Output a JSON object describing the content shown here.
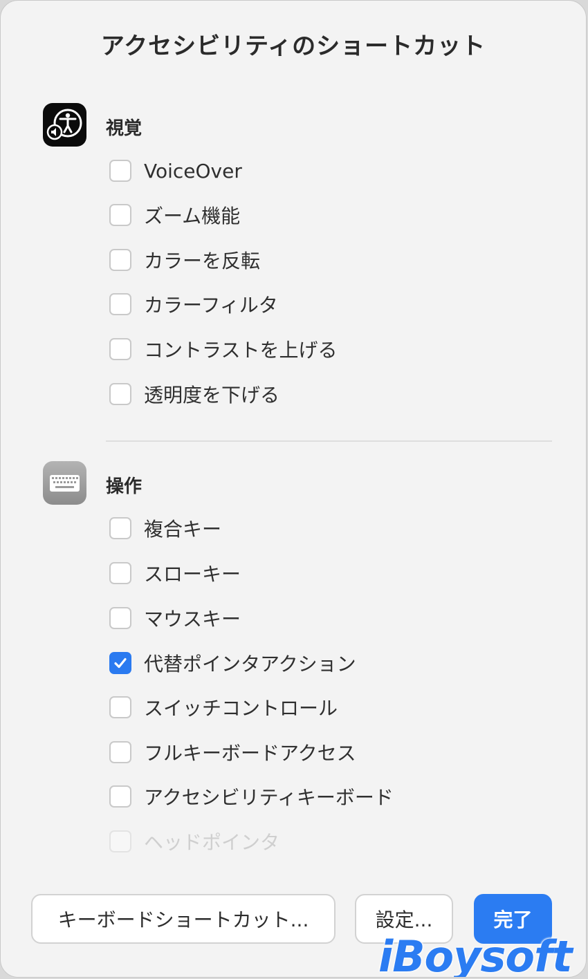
{
  "dialog": {
    "title": "アクセシビリティのショートカット"
  },
  "sections": [
    {
      "title": "視覚",
      "icon": "accessibility-icon",
      "items": [
        {
          "label": "VoiceOver",
          "checked": false,
          "enabled": true
        },
        {
          "label": "ズーム機能",
          "checked": false,
          "enabled": true
        },
        {
          "label": "カラーを反転",
          "checked": false,
          "enabled": true
        },
        {
          "label": "カラーフィルタ",
          "checked": false,
          "enabled": true
        },
        {
          "label": "コントラストを上げる",
          "checked": false,
          "enabled": true
        },
        {
          "label": "透明度を下げる",
          "checked": false,
          "enabled": true
        }
      ]
    },
    {
      "title": "操作",
      "icon": "keyboard-icon",
      "items": [
        {
          "label": "複合キー",
          "checked": false,
          "enabled": true
        },
        {
          "label": "スローキー",
          "checked": false,
          "enabled": true
        },
        {
          "label": "マウスキー",
          "checked": false,
          "enabled": true
        },
        {
          "label": "代替ポインタアクション",
          "checked": true,
          "enabled": true
        },
        {
          "label": "スイッチコントロール",
          "checked": false,
          "enabled": true
        },
        {
          "label": "フルキーボードアクセス",
          "checked": false,
          "enabled": true
        },
        {
          "label": "アクセシビリティキーボード",
          "checked": false,
          "enabled": true
        },
        {
          "label": "ヘッドポインタ",
          "checked": false,
          "enabled": false
        }
      ]
    }
  ],
  "buttons": {
    "keyboard_shortcuts": "キーボードショートカット...",
    "settings": "設定...",
    "done": "完了"
  },
  "watermark": "iBoysoft",
  "colors": {
    "accent": "#2b7cf2",
    "background": "#f3f3f3"
  }
}
